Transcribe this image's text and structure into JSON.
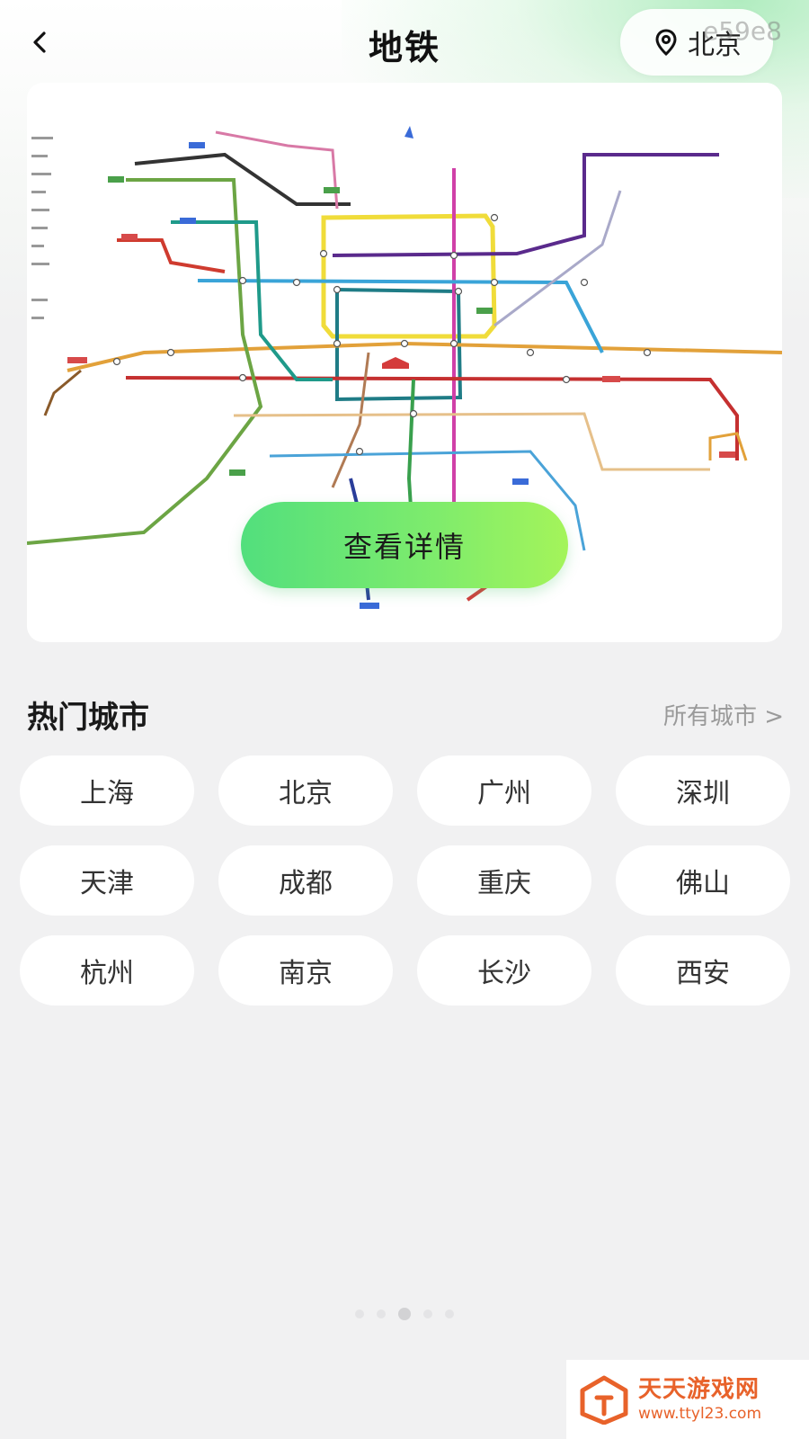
{
  "header": {
    "title": "地铁",
    "location": "北京",
    "overlay_code": "e59e8"
  },
  "map_card": {
    "detail_button": "查看详情"
  },
  "hot_cities": {
    "title": "热门城市",
    "all_link": "所有城市 >",
    "cities": [
      "上海",
      "北京",
      "广州",
      "深圳",
      "天津",
      "成都",
      "重庆",
      "佛山",
      "杭州",
      "南京",
      "长沙",
      "西安"
    ]
  },
  "pager": {
    "count": 5,
    "active_index": 2
  },
  "watermark": {
    "name": "天天游戏网",
    "url": "www.ttyl23.com"
  },
  "colors": {
    "accent_green": "#52df7d",
    "accent_lime": "#a4f45a",
    "watermark_orange": "#e8622a"
  },
  "icons": {
    "back": "chevron-left-icon",
    "location": "location-pin-icon",
    "logo": "house-logo-icon"
  }
}
